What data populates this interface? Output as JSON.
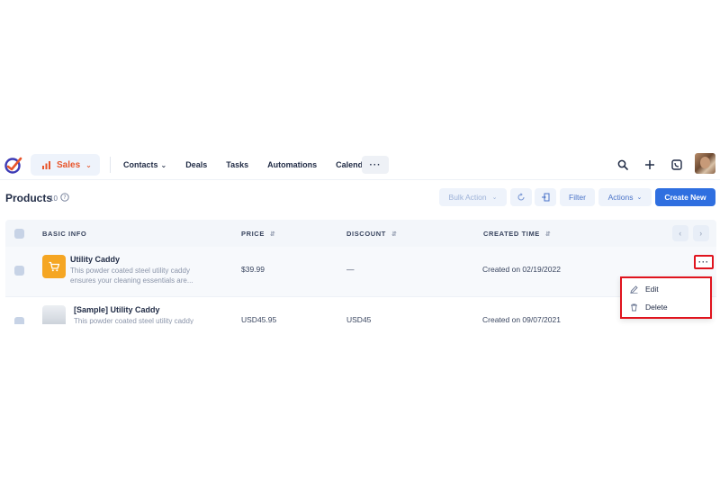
{
  "nav": {
    "app_name": "Sales",
    "items": [
      {
        "label": "Contacts",
        "has_dropdown": true
      },
      {
        "label": "Deals",
        "has_dropdown": false
      },
      {
        "label": "Tasks",
        "has_dropdown": false
      },
      {
        "label": "Automations",
        "has_dropdown": false
      },
      {
        "label": "Calendar",
        "has_dropdown": false
      }
    ],
    "more": "···",
    "icons": [
      "search-icon",
      "plus-icon",
      "dialer-icon",
      "avatar"
    ]
  },
  "header": {
    "title": "Products",
    "count": "10",
    "bulk_action": "Bulk Action",
    "filter": "Filter",
    "actions": "Actions",
    "create": "Create New"
  },
  "table": {
    "columns": [
      "BASIC INFO",
      "PRICE",
      "DISCOUNT",
      "CREATED TIME"
    ],
    "rows": [
      {
        "name": "Utility Caddy",
        "desc": "This powder coated steel utility caddy",
        "desc2": "ensures your cleaning essentials are...",
        "price": "$39.99",
        "discount": "—",
        "created": "Created on 02/19/2022"
      },
      {
        "name": "[Sample] Utility Caddy",
        "desc": "This powder coated steel utility caddy",
        "price": "USD45.95",
        "discount": "USD45",
        "created": "Created on 09/07/2021"
      }
    ]
  },
  "row_menu": {
    "more": "···",
    "edit": "Edit",
    "delete": "Delete"
  },
  "colors": {
    "primary": "#2f6fe0",
    "accent": "#e8552b",
    "highlight": "#e0141e",
    "product_thumb": "#f5a623"
  }
}
